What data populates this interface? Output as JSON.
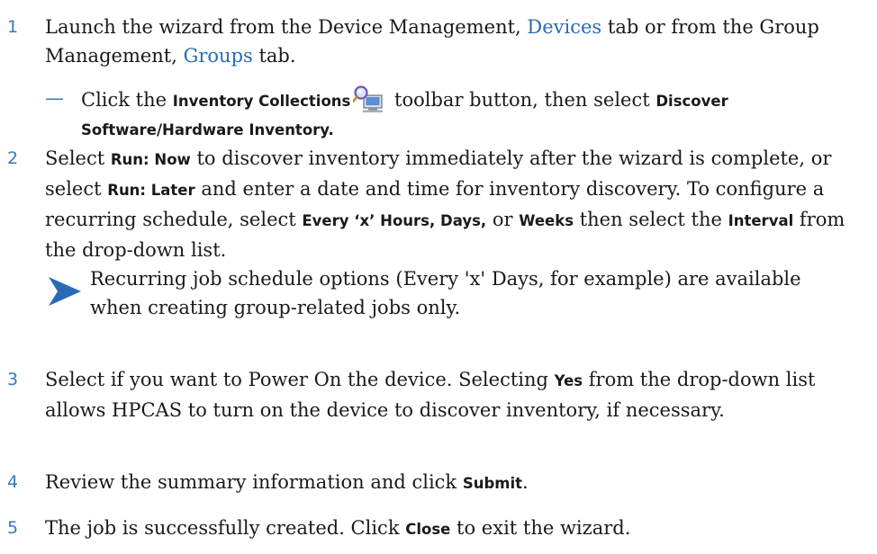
{
  "steps": [
    {
      "num": "1",
      "pre": "Launch the wizard from the Device Management, ",
      "link1": "Devices",
      "mid": " tab or from the Group Management, ",
      "link2": "Groups",
      "post": " tab."
    },
    {
      "num": "2",
      "t1": "Select ",
      "b1": "Run: Now",
      "t2": " to discover inventory immediately after the wizard is complete, or select ",
      "b2": "Run: Later",
      "t3": " and enter a date and time for inventory discovery. To configure a recurring schedule, select ",
      "b3": "Every ‘x’ Hours, Days,",
      "t4": " or ",
      "b4": "Weeks",
      "t5": " then select the ",
      "b5": "Interval",
      "t6": " from the drop-down list."
    },
    {
      "num": "3",
      "t1": "Select if you want to Power On the device. Selecting ",
      "b1": "Yes",
      "t2": " from the drop-down list allows HPCAS to turn on the device to discover inventory, if necessary."
    },
    {
      "num": "4",
      "t1": "Review the summary information and click ",
      "b1": "Submit",
      "t2": "."
    },
    {
      "num": "5",
      "t1": "The job is successfully created. Click ",
      "b1": "Close",
      "t2": " to exit the wizard."
    }
  ],
  "substep": {
    "dash": "—",
    "t1": "Click the ",
    "b1": "Inventory Collections",
    "icon": "inventory-collections-icon",
    "t2": " toolbar button, then select ",
    "b2": "Discover Software/Hardware Inventory."
  },
  "note": {
    "icon": "note-arrow-icon",
    "text": "Recurring job schedule options (Every 'x' Days, for example) are available when creating group-related jobs only."
  },
  "colors": {
    "number": "#3a78b8",
    "link": "#2a6ab5",
    "arrow": "#2a6ab5"
  }
}
